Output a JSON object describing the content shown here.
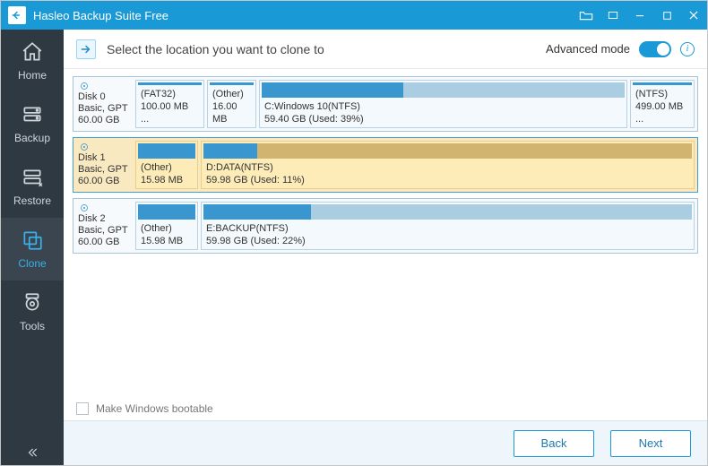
{
  "app": {
    "title": "Hasleo Backup Suite Free"
  },
  "sidebar": {
    "items": [
      {
        "key": "home",
        "label": "Home"
      },
      {
        "key": "backup",
        "label": "Backup"
      },
      {
        "key": "restore",
        "label": "Restore"
      },
      {
        "key": "clone",
        "label": "Clone"
      },
      {
        "key": "tools",
        "label": "Tools"
      }
    ],
    "active": "clone"
  },
  "header": {
    "title": "Select the location you want to clone to",
    "advanced_label": "Advanced mode",
    "advanced_on": true
  },
  "disks": [
    {
      "key": "disk0",
      "name": "Disk 0",
      "scheme": "Basic, GPT",
      "size": "60.00 GB",
      "selected": false,
      "partitions": [
        {
          "label": "(FAT32)",
          "sub": "100.00 MB ...",
          "flex": 77,
          "used_pct": 100
        },
        {
          "label": "(Other)",
          "sub": "16.00 MB",
          "flex": 55,
          "used_pct": 100
        },
        {
          "label": "C:Windows 10(NTFS)",
          "sub": "59.40 GB (Used: 39%)",
          "flex": 380,
          "used_pct": 39
        },
        {
          "label": "(NTFS)",
          "sub": "499.00 MB ...",
          "flex": 72,
          "used_pct": 100
        }
      ]
    },
    {
      "key": "disk1",
      "name": "Disk 1",
      "scheme": "Basic, GPT",
      "size": "60.00 GB",
      "selected": true,
      "partitions": [
        {
          "label": "(Other)",
          "sub": "15.98 MB",
          "flex": 70,
          "used_pct": 100
        },
        {
          "label": "D:DATA(NTFS)",
          "sub": "59.98 GB (Used: 11%)",
          "flex": 540,
          "used_pct": 11
        }
      ]
    },
    {
      "key": "disk2",
      "name": "Disk 2",
      "scheme": "Basic, GPT",
      "size": "60.00 GB",
      "selected": false,
      "partitions": [
        {
          "label": "(Other)",
          "sub": "15.98 MB",
          "flex": 70,
          "used_pct": 100
        },
        {
          "label": "E:BACKUP(NTFS)",
          "sub": "59.98 GB (Used: 22%)",
          "flex": 540,
          "used_pct": 22
        }
      ]
    }
  ],
  "options": {
    "make_bootable_label": "Make Windows bootable",
    "make_bootable_checked": false
  },
  "footer": {
    "back": "Back",
    "next": "Next"
  }
}
